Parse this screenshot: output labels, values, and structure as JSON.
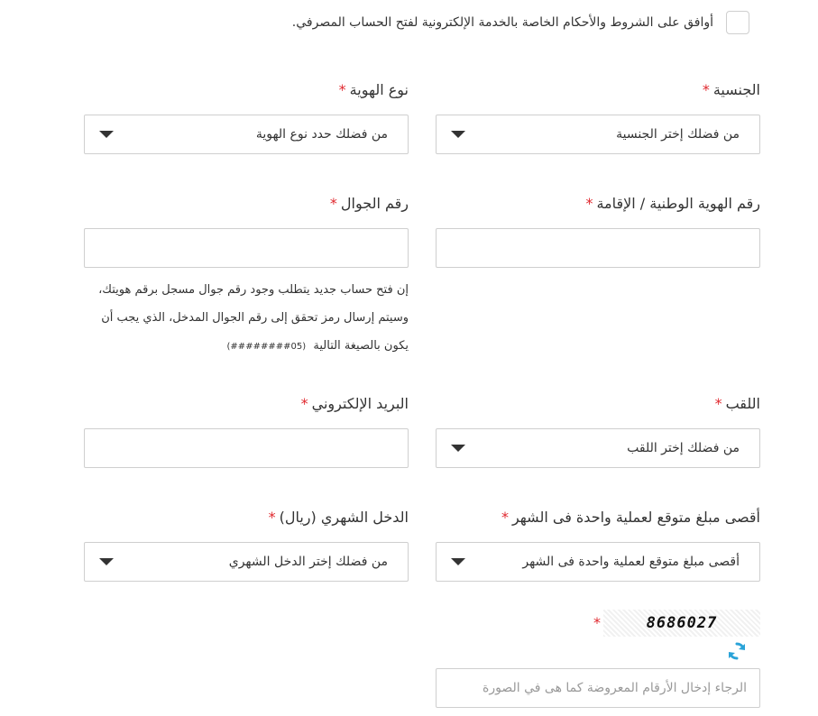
{
  "terms": {
    "text": "أوافق على الشروط والأحكام الخاصة بالخدمة الإلكترونية لفتح الحساب المصرفي."
  },
  "required_mark": "*",
  "fields": {
    "nationality": {
      "label": "الجنسية",
      "value": "من فضلك إختر الجنسية"
    },
    "id_type": {
      "label": "نوع الهوية",
      "value": "من فضلك حدد نوع الهوية"
    },
    "national_id": {
      "label": "رقم الهوية الوطنية / الإقامة",
      "value": ""
    },
    "mobile": {
      "label": "رقم الجوال",
      "value": ""
    },
    "title": {
      "label": "اللقب",
      "value": "من فضلك إختر اللقب"
    },
    "email": {
      "label": "البريد الإلكتروني",
      "value": ""
    },
    "max_transaction": {
      "label": "أقصى مبلغ متوقع لعملية واحدة فى الشهر",
      "value": "أقصى مبلغ متوقع لعملية واحدة فى الشهر"
    },
    "monthly_income": {
      "label": "الدخل الشهري (ريال)",
      "value": "من فضلك إختر الدخل الشهري"
    }
  },
  "mobile_help": {
    "line1": "إن فتح حساب جديد يتطلب وجود رقم جوال مسجل برقم هويتك،",
    "line2": "وسيتم إرسال رمز تحقق إلى رقم الجوال المدخل، الذي يجب أن",
    "line3": "يكون بالصيغة التالية",
    "format": "(05########)"
  },
  "captcha": {
    "code": "8686027",
    "placeholder": "الرجاء إدخال الأرقام المعروضة كما هى في الصورة"
  },
  "colors": {
    "required": "#e0282e",
    "refresh_icon": "#2aa3d8",
    "border": "#cfcfcf"
  }
}
